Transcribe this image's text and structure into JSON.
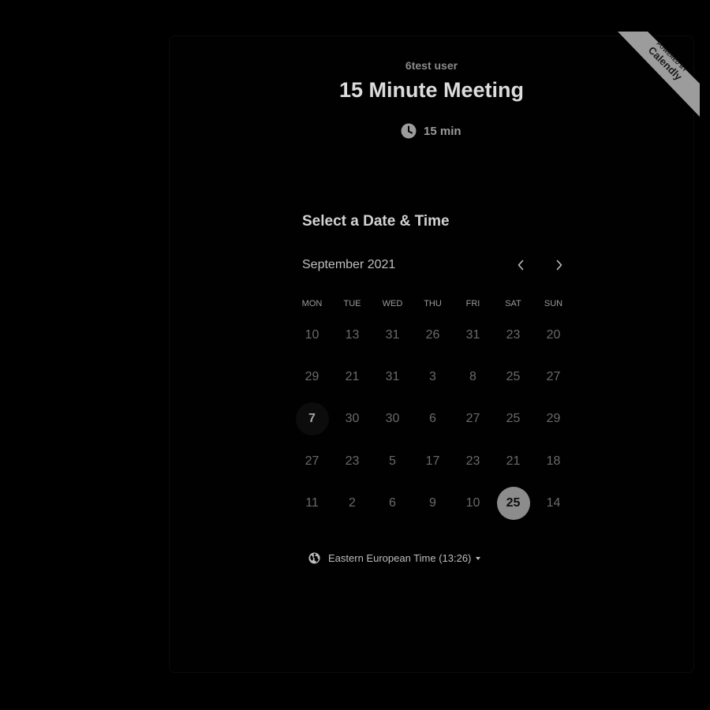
{
  "event": {
    "owner": "6test user",
    "title": "15 Minute Meeting",
    "duration": "15 min",
    "duration_icon": "clock-icon"
  },
  "badge": {
    "powered_by": "POWERED BY",
    "brand": "Calendly",
    "color": "#9c9c9c"
  },
  "scheduler": {
    "heading": "Select a Date & Time",
    "month": "September 2021",
    "prev_icon": "chevron-left-icon",
    "next_icon": "chevron-right-icon",
    "weekdays": [
      "MON",
      "TUE",
      "WED",
      "THU",
      "FRI",
      "SAT",
      "SUN"
    ],
    "weeks": [
      [
        "10",
        "13",
        "31",
        "26",
        "31",
        "23",
        "20"
      ],
      [
        "29",
        "21",
        "31",
        "3",
        "8",
        "25",
        "27"
      ],
      [
        "7",
        "30",
        "30",
        "6",
        "27",
        "25",
        "29"
      ],
      [
        "27",
        "23",
        "5",
        "17",
        "23",
        "21",
        "18"
      ],
      [
        "11",
        "2",
        "6",
        "9",
        "10",
        "25",
        "14"
      ]
    ],
    "today": {
      "week": 2,
      "day": 0
    },
    "selected": {
      "week": 4,
      "day": 5
    }
  },
  "timezone": {
    "label": "Eastern European Time (13:26)",
    "icon": "globe-icon"
  },
  "colors": {
    "background": "#000000",
    "accent": "#8c8c8c",
    "text": "#dcdcdc"
  }
}
